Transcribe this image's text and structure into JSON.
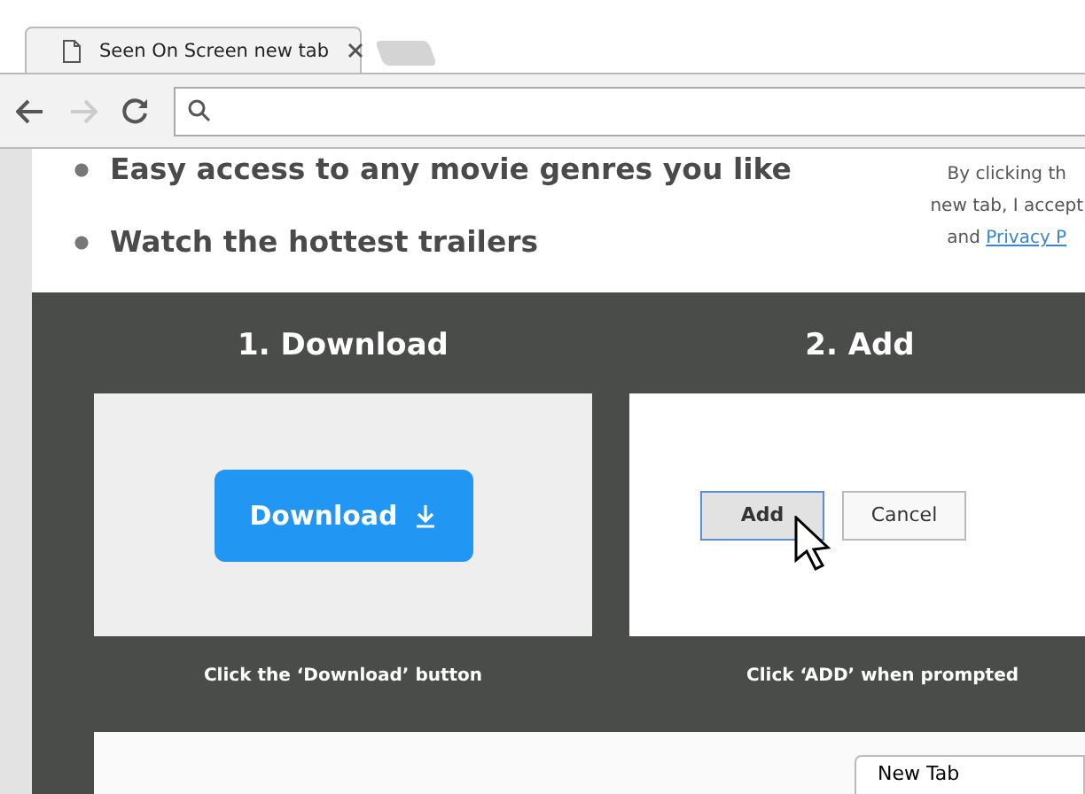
{
  "browser": {
    "tabs": [
      {
        "title": "Seen On Screen new tab",
        "selected": true
      }
    ]
  },
  "page": {
    "bullets": [
      "Easy access to any movie genres you like",
      "Watch the hottest trailers"
    ],
    "consent": {
      "lines": [
        "By clicking th",
        "new tab, I accept"
      ],
      "and": "and",
      "link": "Privacy P"
    },
    "steps": [
      {
        "kind": "download",
        "heading": "1. Download",
        "button": "Download",
        "caption": "Click the ‘Download’ button"
      },
      {
        "kind": "add",
        "heading": "2. Add",
        "buttons": [
          "Add",
          "Cancel"
        ],
        "caption": "Click ‘ADD’ when prompted"
      }
    ],
    "popup_tab": "New Tab"
  }
}
